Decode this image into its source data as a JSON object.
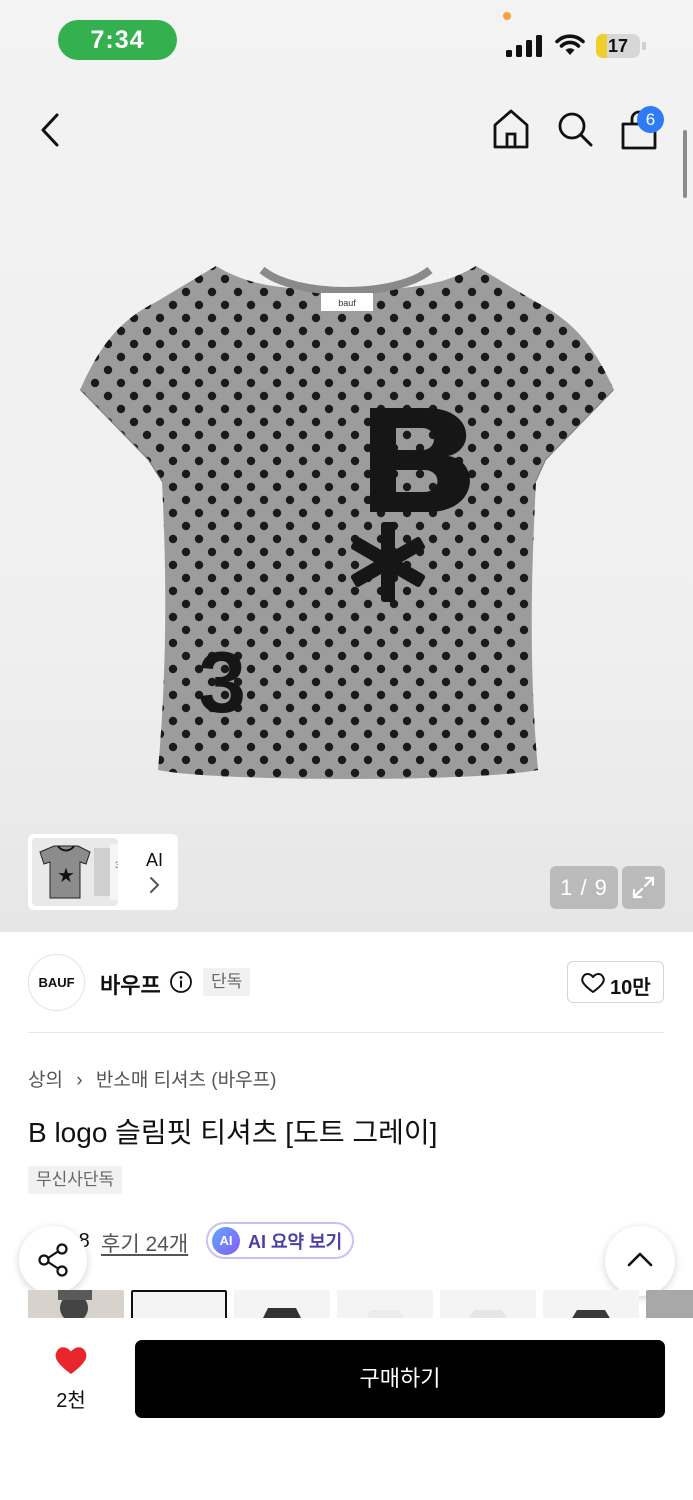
{
  "status_bar": {
    "time": "7:34",
    "battery": "17",
    "battery_level": 0.17
  },
  "nav": {
    "cart_count": "6"
  },
  "gallery": {
    "counter": "1 / 9",
    "ai_label": "AI"
  },
  "brand": {
    "logo_text": "BAUF",
    "name": "바우프",
    "exclusive_tag": "단독",
    "likes": "10만"
  },
  "breadcrumb": {
    "category": "상의",
    "subcategory": "반소매 티셔츠 (바우프)"
  },
  "product": {
    "title": "B logo 슬림핏 티셔츠 [도트 그레이]",
    "tag": "무신사단독"
  },
  "rating": {
    "value": "4.8",
    "reviews": "후기 24개",
    "ai_summary_badge": "AI",
    "ai_summary_label": "AI 요약 보기"
  },
  "bottom_bar": {
    "wish_count": "2천",
    "buy_label": "구매하기"
  },
  "colors": {
    "accent_blue": "#2f7bf5",
    "status_green": "#34b04e",
    "heart_red": "#e8262c",
    "buy_black": "#000000"
  }
}
